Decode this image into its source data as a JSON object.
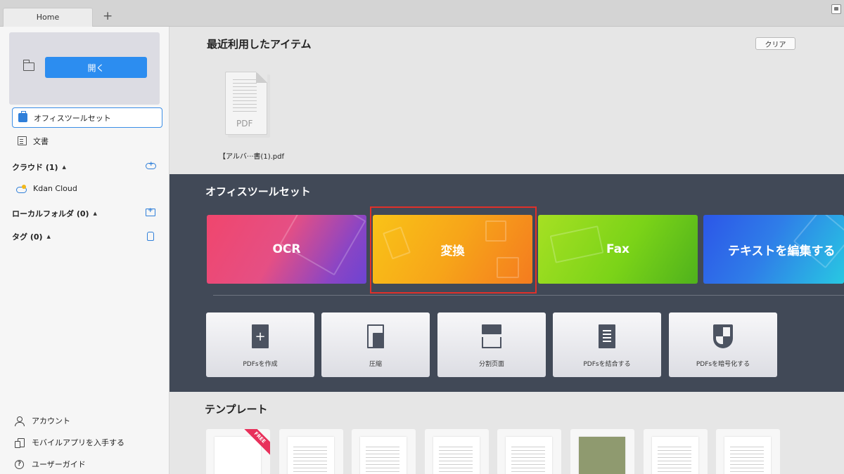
{
  "tabs": {
    "home_label": "Home",
    "add_symbol": "+"
  },
  "sidebar": {
    "open_button": "開く",
    "items": [
      {
        "label": "オフィスツールセット",
        "icon": "toolbox-icon",
        "active": true
      },
      {
        "label": "文書",
        "icon": "document-icon",
        "active": false
      }
    ],
    "cloud": {
      "label": "クラウド (1)",
      "items": [
        {
          "label": "Kdan Cloud"
        }
      ]
    },
    "local_folder": {
      "label": "ローカルフォルダ (0)"
    },
    "tags": {
      "label": "タグ (0)"
    },
    "bottom": [
      {
        "label": "アカウント",
        "icon": "account-icon"
      },
      {
        "label": "モバイルアプリを入手する",
        "icon": "mobile-app-icon"
      },
      {
        "label": "ユーザーガイド",
        "icon": "help-icon"
      }
    ]
  },
  "recent": {
    "title": "最近利用したアイテム",
    "clear_button": "クリア",
    "files": [
      {
        "name": "【アルバ···書(1).pdf",
        "type": "PDF"
      }
    ]
  },
  "office_tools": {
    "title": "オフィスツールセット",
    "cards": [
      {
        "label": "OCR",
        "color": "#e54f84"
      },
      {
        "label": "変換",
        "color": "#f7a519"
      },
      {
        "label": "Fax",
        "color": "#7bd318"
      },
      {
        "label": "テキストを編集する",
        "color": "#2f7de8"
      }
    ],
    "tools": [
      {
        "label": "PDFsを作成",
        "icon": "create-pdf-icon"
      },
      {
        "label": "圧縮",
        "icon": "compress-icon"
      },
      {
        "label": "分割页面",
        "icon": "split-pages-icon"
      },
      {
        "label": "PDFsを結合する",
        "icon": "merge-pdf-icon"
      },
      {
        "label": "PDFsを暗号化する",
        "icon": "encrypt-pdf-icon"
      }
    ]
  },
  "templates": {
    "title": "テンプレート",
    "badge": "FREE",
    "count": 8
  }
}
